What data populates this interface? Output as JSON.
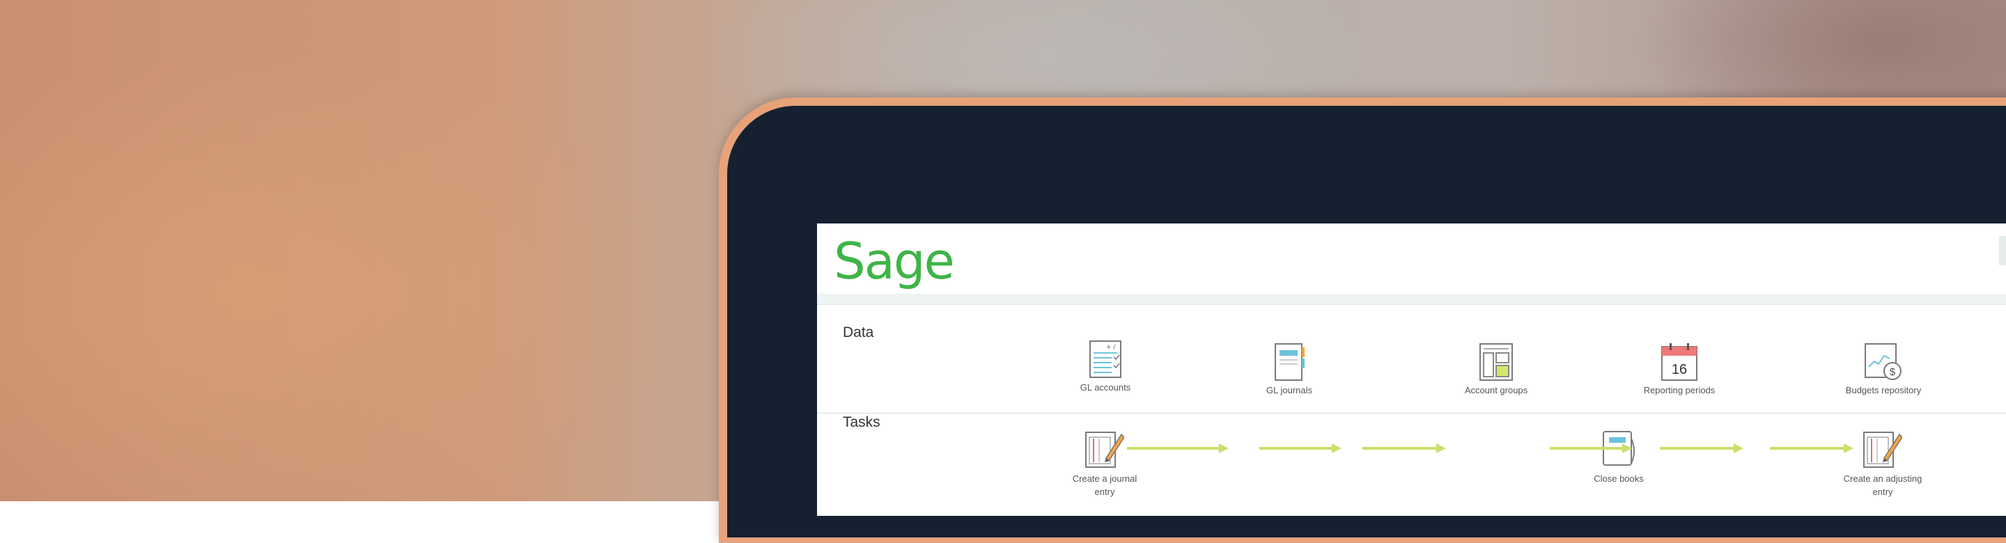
{
  "app": {
    "brand": "Sage",
    "brand_color": "#3fb447"
  },
  "sections": [
    {
      "title": "Data",
      "items": [
        {
          "label": "GL accounts",
          "icon": "gl-accounts-icon"
        },
        {
          "label": "GL journals",
          "icon": "gl-journals-icon"
        },
        {
          "label": "Account groups",
          "icon": "account-groups-icon"
        },
        {
          "label": "Reporting periods",
          "icon": "calendar-icon",
          "day": "16"
        },
        {
          "label": "Budgets repository",
          "icon": "budgets-icon"
        }
      ]
    },
    {
      "title": "Tasks",
      "items": [
        {
          "label": "Create a journal entry",
          "icon": "journal-entry-icon"
        },
        {
          "label": "Close books",
          "icon": "close-books-icon"
        },
        {
          "label": "Create an adjusting entry",
          "icon": "adjusting-entry-icon"
        }
      ]
    }
  ],
  "colors": {
    "arrow": "#c9e06b",
    "accent": "#3fb447"
  }
}
